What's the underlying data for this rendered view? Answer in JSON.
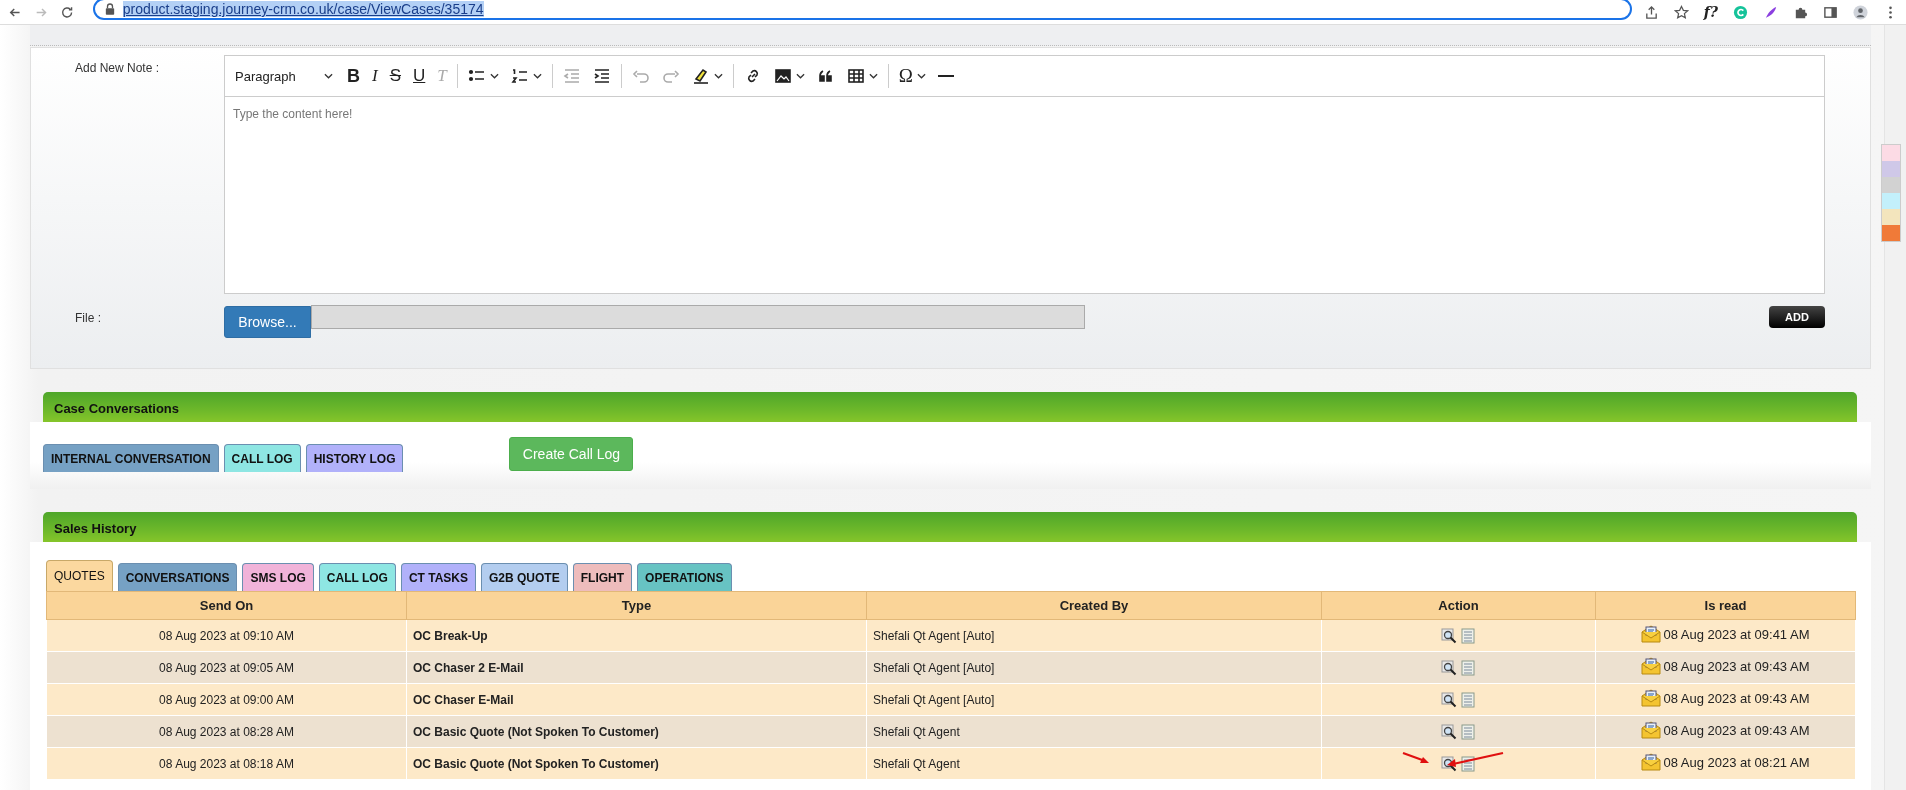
{
  "browser": {
    "url": "product.staging.journey-crm.co.uk/case/ViewCases/35174",
    "extension_text": "f?"
  },
  "note_form": {
    "label": "Add New Note :",
    "editor": {
      "block_format": "Paragraph",
      "placeholder": "Type the content here!",
      "toolbar": [
        {
          "kind": "bold",
          "label": "B",
          "disabled": false
        },
        {
          "kind": "italic",
          "label": "I",
          "disabled": false
        },
        {
          "kind": "strike",
          "label": "S",
          "disabled": false
        },
        {
          "kind": "underline",
          "label": "U",
          "disabled": false
        },
        {
          "kind": "clear",
          "label": "T",
          "disabled": true
        },
        {
          "kind": "separator"
        },
        {
          "kind": "bullets",
          "dropdown": true,
          "disabled": false
        },
        {
          "kind": "numbers",
          "dropdown": true,
          "disabled": false
        },
        {
          "kind": "separator"
        },
        {
          "kind": "outdent",
          "dropdown": false,
          "disabled": true
        },
        {
          "kind": "indent",
          "dropdown": false,
          "disabled": false
        },
        {
          "kind": "separator"
        },
        {
          "kind": "undo",
          "dropdown": false,
          "disabled": true
        },
        {
          "kind": "redo",
          "dropdown": false,
          "disabled": true
        },
        {
          "kind": "highlight",
          "dropdown": true,
          "disabled": false
        },
        {
          "kind": "separator"
        },
        {
          "kind": "link",
          "dropdown": false,
          "disabled": false
        },
        {
          "kind": "image",
          "dropdown": true,
          "disabled": false
        },
        {
          "kind": "quote",
          "dropdown": false,
          "disabled": false
        },
        {
          "kind": "table",
          "dropdown": true,
          "disabled": false
        },
        {
          "kind": "separator"
        },
        {
          "kind": "symbol",
          "label": "Ω",
          "dropdown": true,
          "disabled": false
        },
        {
          "kind": "hr",
          "dropdown": false,
          "disabled": false
        }
      ]
    },
    "file_label": "File :",
    "browse_button": "Browse...",
    "add_button": "ADD"
  },
  "case_conversations": {
    "title": "Case Conversations",
    "tabs": [
      {
        "label": "INTERNAL CONVERSATION",
        "color": "#76a1c4",
        "selected": false
      },
      {
        "label": "CALL LOG",
        "color": "#8ee6e3",
        "selected": false
      },
      {
        "label": "HISTORY LOG",
        "color": "#b1b1fa",
        "selected": false
      }
    ],
    "create_button": "Create Call Log"
  },
  "sales_history": {
    "title": "Sales History",
    "tabs": [
      {
        "label": "QUOTES",
        "color": "#fbd89f",
        "selected": true
      },
      {
        "label": "CONVERSATIONS",
        "color": "#76a1c4",
        "selected": false
      },
      {
        "label": "SMS LOG",
        "color": "#f1b3d9",
        "selected": false
      },
      {
        "label": "CALL LOG",
        "color": "#8ee6e3",
        "selected": false
      },
      {
        "label": "CT TASKS",
        "color": "#b1b1fa",
        "selected": false
      },
      {
        "label": "G2B QUOTE",
        "color": "#b3cdef",
        "selected": false
      },
      {
        "label": "FLIGHT",
        "color": "#eebcbc",
        "selected": false
      },
      {
        "label": "OPERATIONS",
        "color": "#67c3c3",
        "selected": false
      }
    ],
    "table": {
      "columns": [
        "Send On",
        "Type",
        "Created By",
        "Action",
        "Is read"
      ],
      "rows": [
        {
          "send_on": "08 Aug 2023 at 09:10 AM",
          "type": "OC Break-Up",
          "created_by": "Shefali Qt Agent [Auto]",
          "is_read": "08 Aug 2023 at 09:41 AM",
          "annotated": false
        },
        {
          "send_on": "08 Aug 2023 at 09:05 AM",
          "type": "OC Chaser 2 E-Mail",
          "created_by": "Shefali Qt Agent [Auto]",
          "is_read": "08 Aug 2023 at 09:43 AM",
          "annotated": false
        },
        {
          "send_on": "08 Aug 2023 at 09:00 AM",
          "type": "OC Chaser E-Mail",
          "created_by": "Shefali Qt Agent [Auto]",
          "is_read": "08 Aug 2023 at 09:43 AM",
          "annotated": false
        },
        {
          "send_on": "08 Aug 2023 at 08:28 AM",
          "type": "OC Basic Quote (Not Spoken To Customer)",
          "created_by": "Shefali Qt Agent",
          "is_read": "08 Aug 2023 at 09:43 AM",
          "annotated": false
        },
        {
          "send_on": "08 Aug 2023 at 08:18 AM",
          "type": "OC Basic Quote (Not Spoken To Customer)",
          "created_by": "Shefali Qt Agent",
          "is_read": "08 Aug 2023 at 08:21 AM",
          "annotated": true
        }
      ]
    }
  },
  "color_swatches": [
    {
      "color": "#fcdbe5"
    },
    {
      "color": "#cfc8e8"
    },
    {
      "color": "#d2d2d2"
    },
    {
      "color": "#c3f0fb"
    },
    {
      "color": "#f3e5bd"
    },
    {
      "color": "#f07a38"
    }
  ]
}
